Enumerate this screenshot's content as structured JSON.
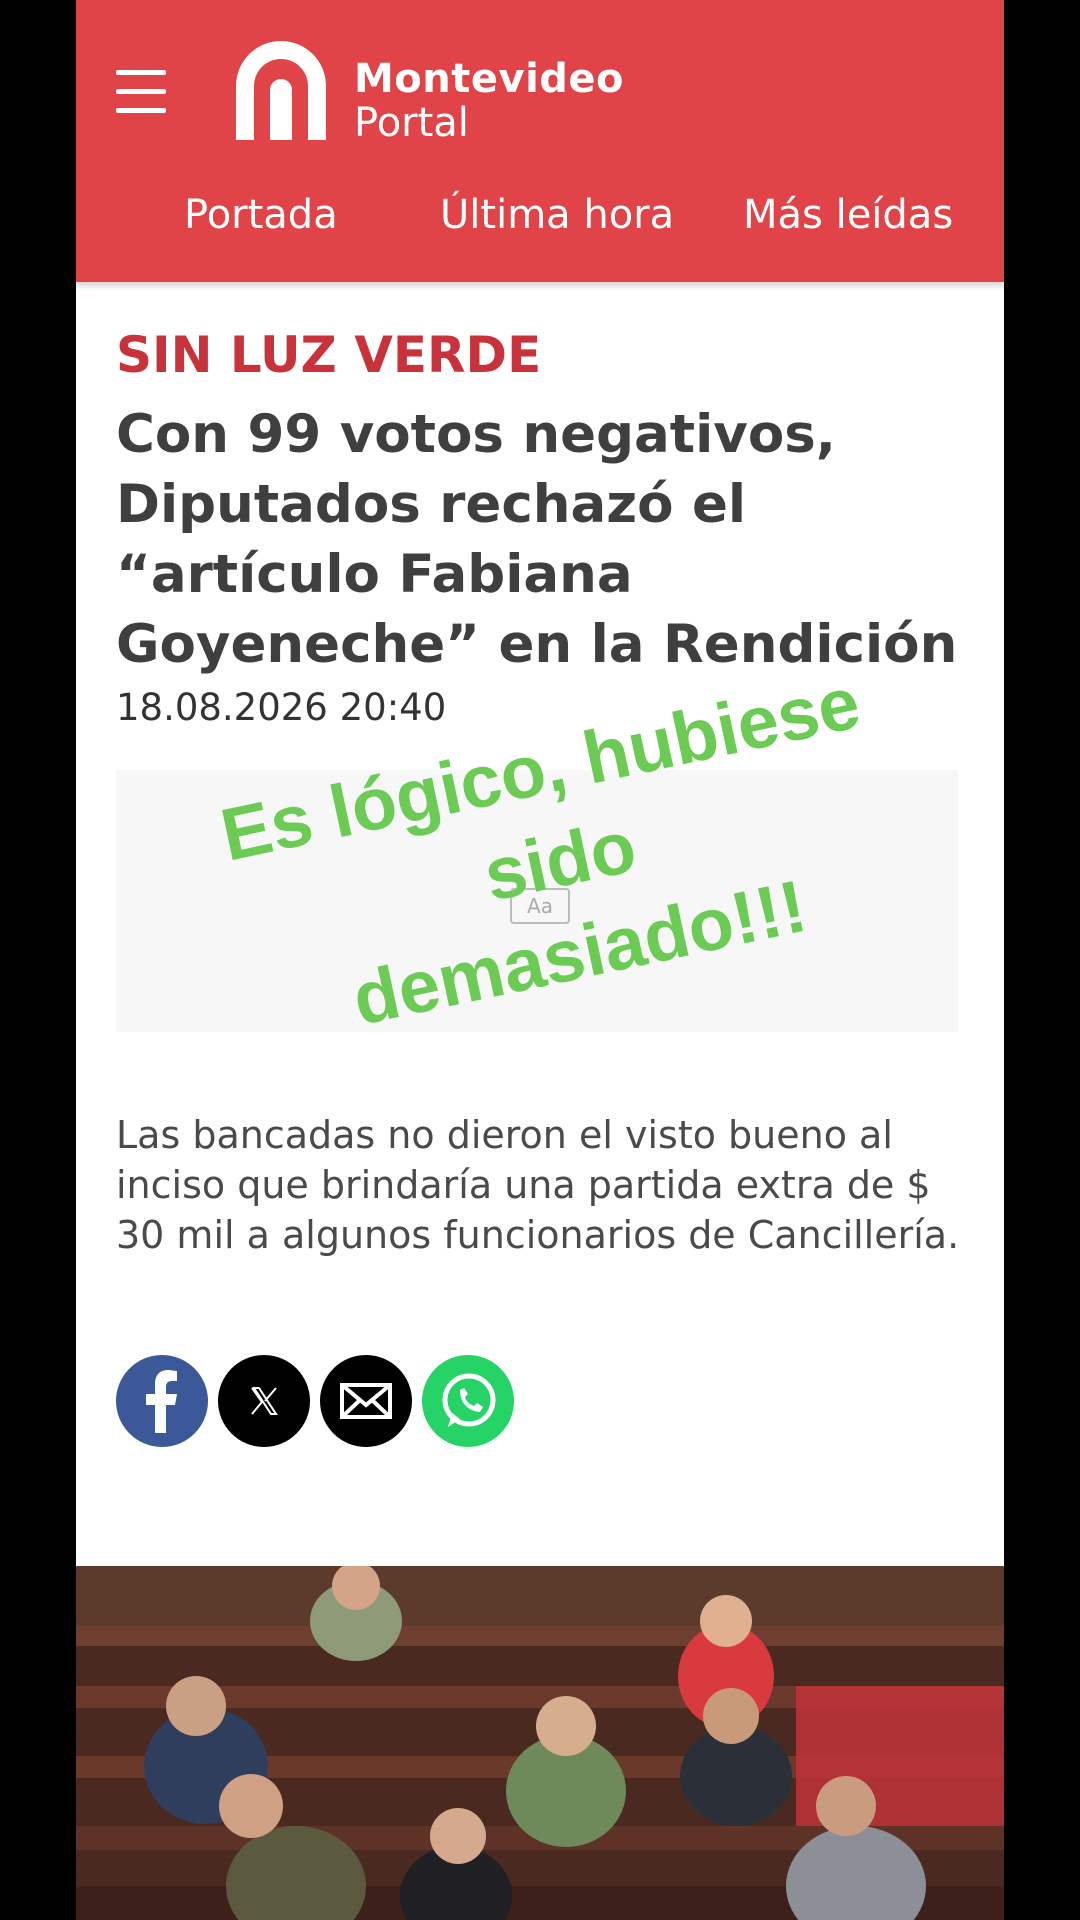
{
  "site": {
    "brand_line1": "Montevideo",
    "brand_line2": "Portal",
    "header_color": "#e04448"
  },
  "nav": {
    "items": [
      {
        "label": "Portada"
      },
      {
        "label": "Última hora"
      },
      {
        "label": "Más leídas"
      }
    ]
  },
  "article": {
    "kicker": "SIN LUZ VERDE",
    "headline": "Con 99 votos negativos, Diputados rechazó el “artículo Fabiana Goyeneche” en la Rendición",
    "date": "18.08.2026 20:40",
    "summary": "Las bancadas no dieron el visto bueno al inciso que brindaría una partida extra de $ 30 mil a algunos funcionarios de Cancillería."
  },
  "ad": {
    "icon_text": "Aa"
  },
  "share": [
    {
      "network": "facebook",
      "icon": "facebook-icon",
      "color": "#3b5998"
    },
    {
      "network": "x",
      "icon": "x-icon",
      "color": "#000000"
    },
    {
      "network": "email",
      "icon": "envelope-icon",
      "color": "#000000"
    },
    {
      "network": "whatsapp",
      "icon": "whatsapp-icon",
      "color": "#25d366"
    }
  ],
  "overlay": {
    "text_line1": "Es lógico, hubiese sido",
    "text_line2": "demasiado!!!",
    "color": "#6ccb55"
  }
}
